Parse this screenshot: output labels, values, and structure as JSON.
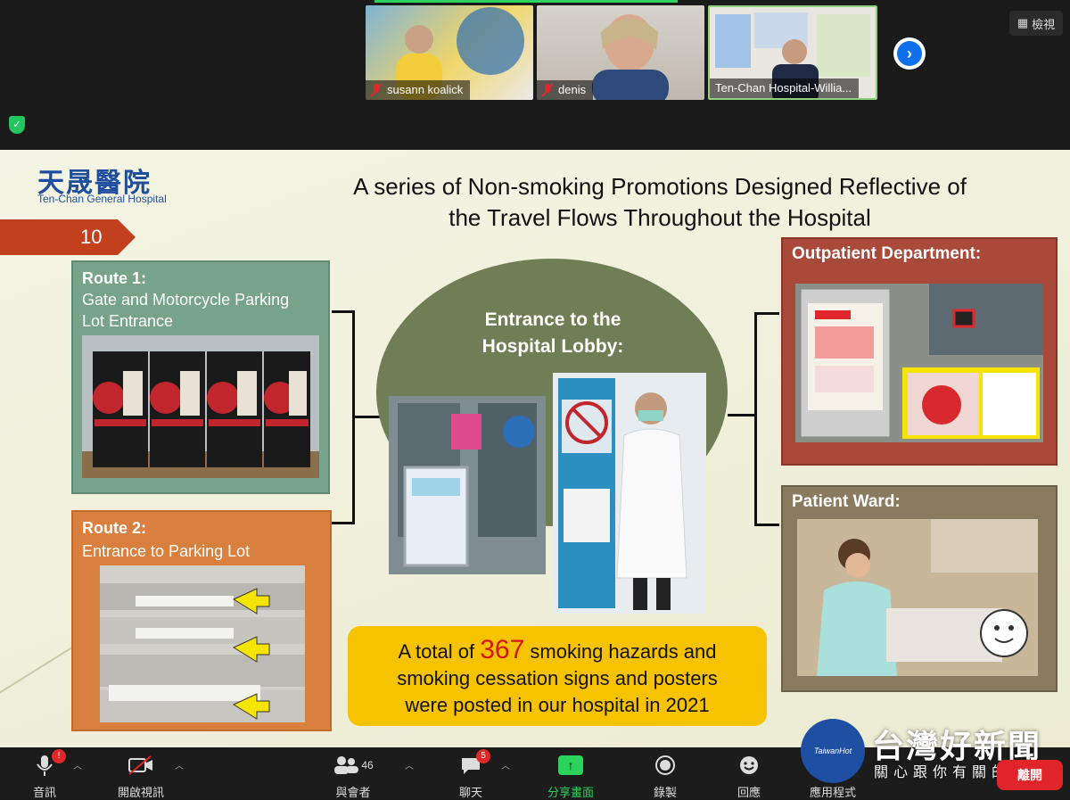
{
  "meeting": {
    "participants": [
      {
        "name": "susann koalick"
      },
      {
        "name": "denis"
      },
      {
        "name": "Ten-Chan Hospital-Willia..."
      }
    ],
    "view_label": "檢視"
  },
  "slide": {
    "logo_cn": "天晟醫院",
    "logo_en": "Ten-Chan General Hospital",
    "title_line1": "A series of Non-smoking Promotions Designed Reflective of",
    "title_line2": "the Travel Flows Throughout the Hospital",
    "page_number": "10",
    "route1": {
      "heading": "Route 1:",
      "line1": "Gate and Motorcycle Parking",
      "line2": "Lot Entrance"
    },
    "route2": {
      "heading": "Route 2:",
      "line1": "Entrance to Parking Lot"
    },
    "lobby": {
      "line1": "Entrance to the",
      "line2": "Hospital Lobby:"
    },
    "outpatient": "Outpatient Department:",
    "ward": "Patient Ward:",
    "note": {
      "prefix": "A total of ",
      "number": "367",
      "suffix": " smoking hazards and",
      "line2": "smoking cessation signs and posters",
      "line3": "were posted in our hospital in 2021"
    }
  },
  "toolbar": {
    "audio": "音訊",
    "video": "開啟視訊",
    "participants": "與會者",
    "participants_count": "46",
    "chat": "聊天",
    "chat_badge": "5",
    "share": "分享畫面",
    "record": "錄製",
    "reactions": "回應",
    "apps": "應用程式",
    "leave": "離開",
    "audio_badge": "!"
  },
  "watermark": {
    "brand": "台灣好新聞",
    "slogan": "關心跟你有關的新聞",
    "badge": "TaiwanHot"
  },
  "colors": {
    "route1": "#76a38a",
    "route2": "#d9803f",
    "outpatient": "#a8493a",
    "ward": "#8a7b60",
    "note": "#f7c200",
    "accent_red": "#d3161c",
    "share_green": "#2bd35c",
    "leave_red": "#e0242a"
  }
}
